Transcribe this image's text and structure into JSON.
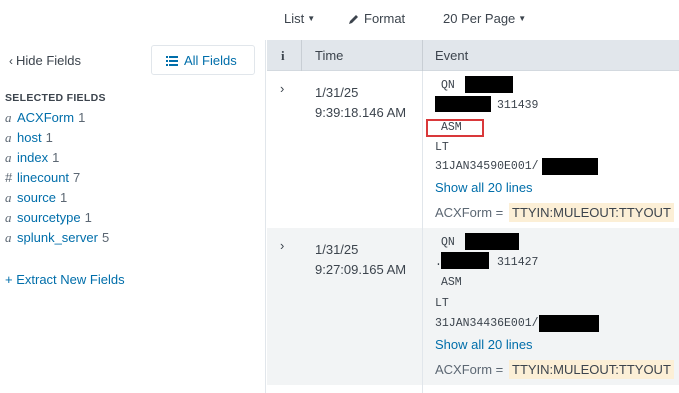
{
  "toolbar": {
    "list_label": "List",
    "format_label": "Format",
    "per_page_label": "20 Per Page"
  },
  "sidebar": {
    "hide_fields_label": "Hide Fields",
    "all_fields_label": "All Fields",
    "selected_title": "SELECTED FIELDS",
    "fields": [
      {
        "type": "a",
        "name": "ACXForm",
        "count": "1"
      },
      {
        "type": "a",
        "name": "host",
        "count": "1"
      },
      {
        "type": "a",
        "name": "index",
        "count": "1"
      },
      {
        "type": "#",
        "name": "linecount",
        "count": "7"
      },
      {
        "type": "a",
        "name": "source",
        "count": "1"
      },
      {
        "type": "a",
        "name": "sourcetype",
        "count": "1"
      },
      {
        "type": "a",
        "name": "splunk_server",
        "count": "5"
      }
    ],
    "extract_label": "+ Extract New Fields"
  },
  "table": {
    "headers": {
      "info": "i",
      "time": "Time",
      "event": "Event"
    },
    "events": [
      {
        "date": "1/31/25",
        "time": "9:39:18.146 AM",
        "line1": "QN",
        "line2": "311439",
        "line3": "ASM",
        "line4": "LT",
        "line5": "31JAN34590E001/",
        "show_all": "Show all 20 lines",
        "acx_label": "ACXForm =",
        "acx_value": "TTYIN:MULEOUT:TTYOUT"
      },
      {
        "date": "1/31/25",
        "time": "9:27:09.165 AM",
        "line1": "QN",
        "line2": "311427",
        "line2_prefix": ".",
        "line3": "ASM",
        "line4": "LT",
        "line5": "31JAN34436E001/",
        "show_all": "Show all 20 lines",
        "acx_label": "ACXForm =",
        "acx_value": "TTYIN:MULEOUT:TTYOUT"
      }
    ]
  },
  "colors": {
    "link": "#006eaa",
    "header_bg": "#e1e6eb",
    "highlight_box": "#d9383a",
    "field_value_bg": "#fcefd6"
  }
}
